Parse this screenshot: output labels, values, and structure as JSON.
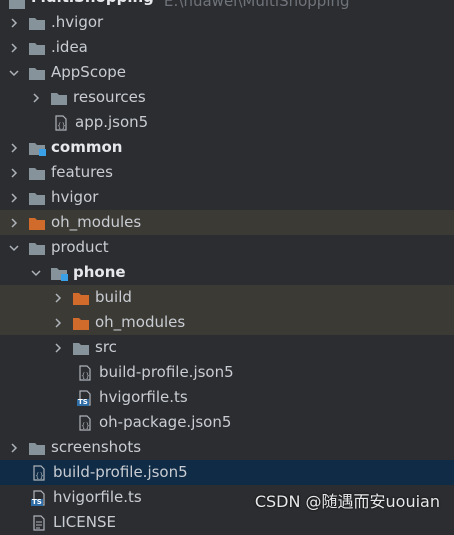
{
  "tree": {
    "root": {
      "label": "MultiShopping",
      "path_hint": "E:\\huawei\\MultiShopping"
    },
    "items": [
      {
        "label": ".hvigor"
      },
      {
        "label": ".idea"
      },
      {
        "label": "AppScope"
      },
      {
        "label": "resources"
      },
      {
        "label": "app.json5"
      },
      {
        "label": "common"
      },
      {
        "label": "features"
      },
      {
        "label": "hvigor"
      },
      {
        "label": "oh_modules"
      },
      {
        "label": "product"
      },
      {
        "label": "phone"
      },
      {
        "label": "build"
      },
      {
        "label": "oh_modules"
      },
      {
        "label": "src"
      },
      {
        "label": "build-profile.json5"
      },
      {
        "label": "hvigorfile.ts"
      },
      {
        "label": "oh-package.json5"
      },
      {
        "label": "screenshots"
      },
      {
        "label": "build-profile.json5"
      },
      {
        "label": "hvigorfile.ts"
      },
      {
        "label": "LICENSE"
      }
    ]
  },
  "watermark": "CSDN @随遇而安uouian",
  "colors": {
    "background": "#2b2d30",
    "folder": "#87939a",
    "excluded_folder": "#d06b2c",
    "excluded_row": "#3b3a35",
    "selected_row": "#0f2b45",
    "module_badge": "#3aa0e8"
  }
}
